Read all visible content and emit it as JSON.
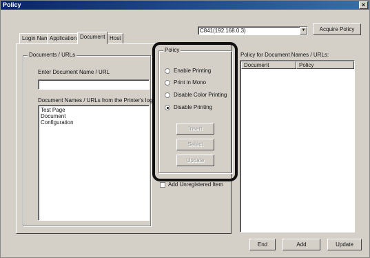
{
  "window": {
    "title": "Policy",
    "close_glyph": "×"
  },
  "tabs": [
    {
      "label": "Login Name"
    },
    {
      "label": "Application"
    },
    {
      "label": "Document"
    },
    {
      "label": "Host"
    }
  ],
  "printer_select": {
    "value": "C841(192.168.0.3)",
    "arrow": "▼"
  },
  "acquire_policy_button": "Acquire Policy",
  "documents_group": {
    "title": "Documents / URLs",
    "enter_label": "Enter Document Name / URL",
    "enter_value": "",
    "log_label": "Document Names / URLs from the Printer's log",
    "log_items": [
      "Test Page",
      "Document",
      "Configuration"
    ]
  },
  "policy_group": {
    "title": "Policy",
    "options": [
      {
        "label": "Enable Printing",
        "checked": false
      },
      {
        "label": "Print in Mono",
        "checked": false
      },
      {
        "label": "Disable Color Printing",
        "checked": false
      },
      {
        "label": "Disable Printing",
        "checked": true
      }
    ],
    "buttons": [
      "Insert",
      "Select",
      "Update"
    ]
  },
  "unregistered_checkbox": {
    "label": "Add Unregistered Item",
    "checked": false
  },
  "policy_list": {
    "title": "Policy for Document Names / URLs:",
    "columns": [
      "Document",
      "Policy"
    ]
  },
  "footer_buttons": {
    "end": "End",
    "add": "Add",
    "update": "Update"
  },
  "colors": {
    "dialog_bg": "#d4d0c8",
    "titlebar": "#0a246a",
    "highlight_border": "#111111"
  }
}
